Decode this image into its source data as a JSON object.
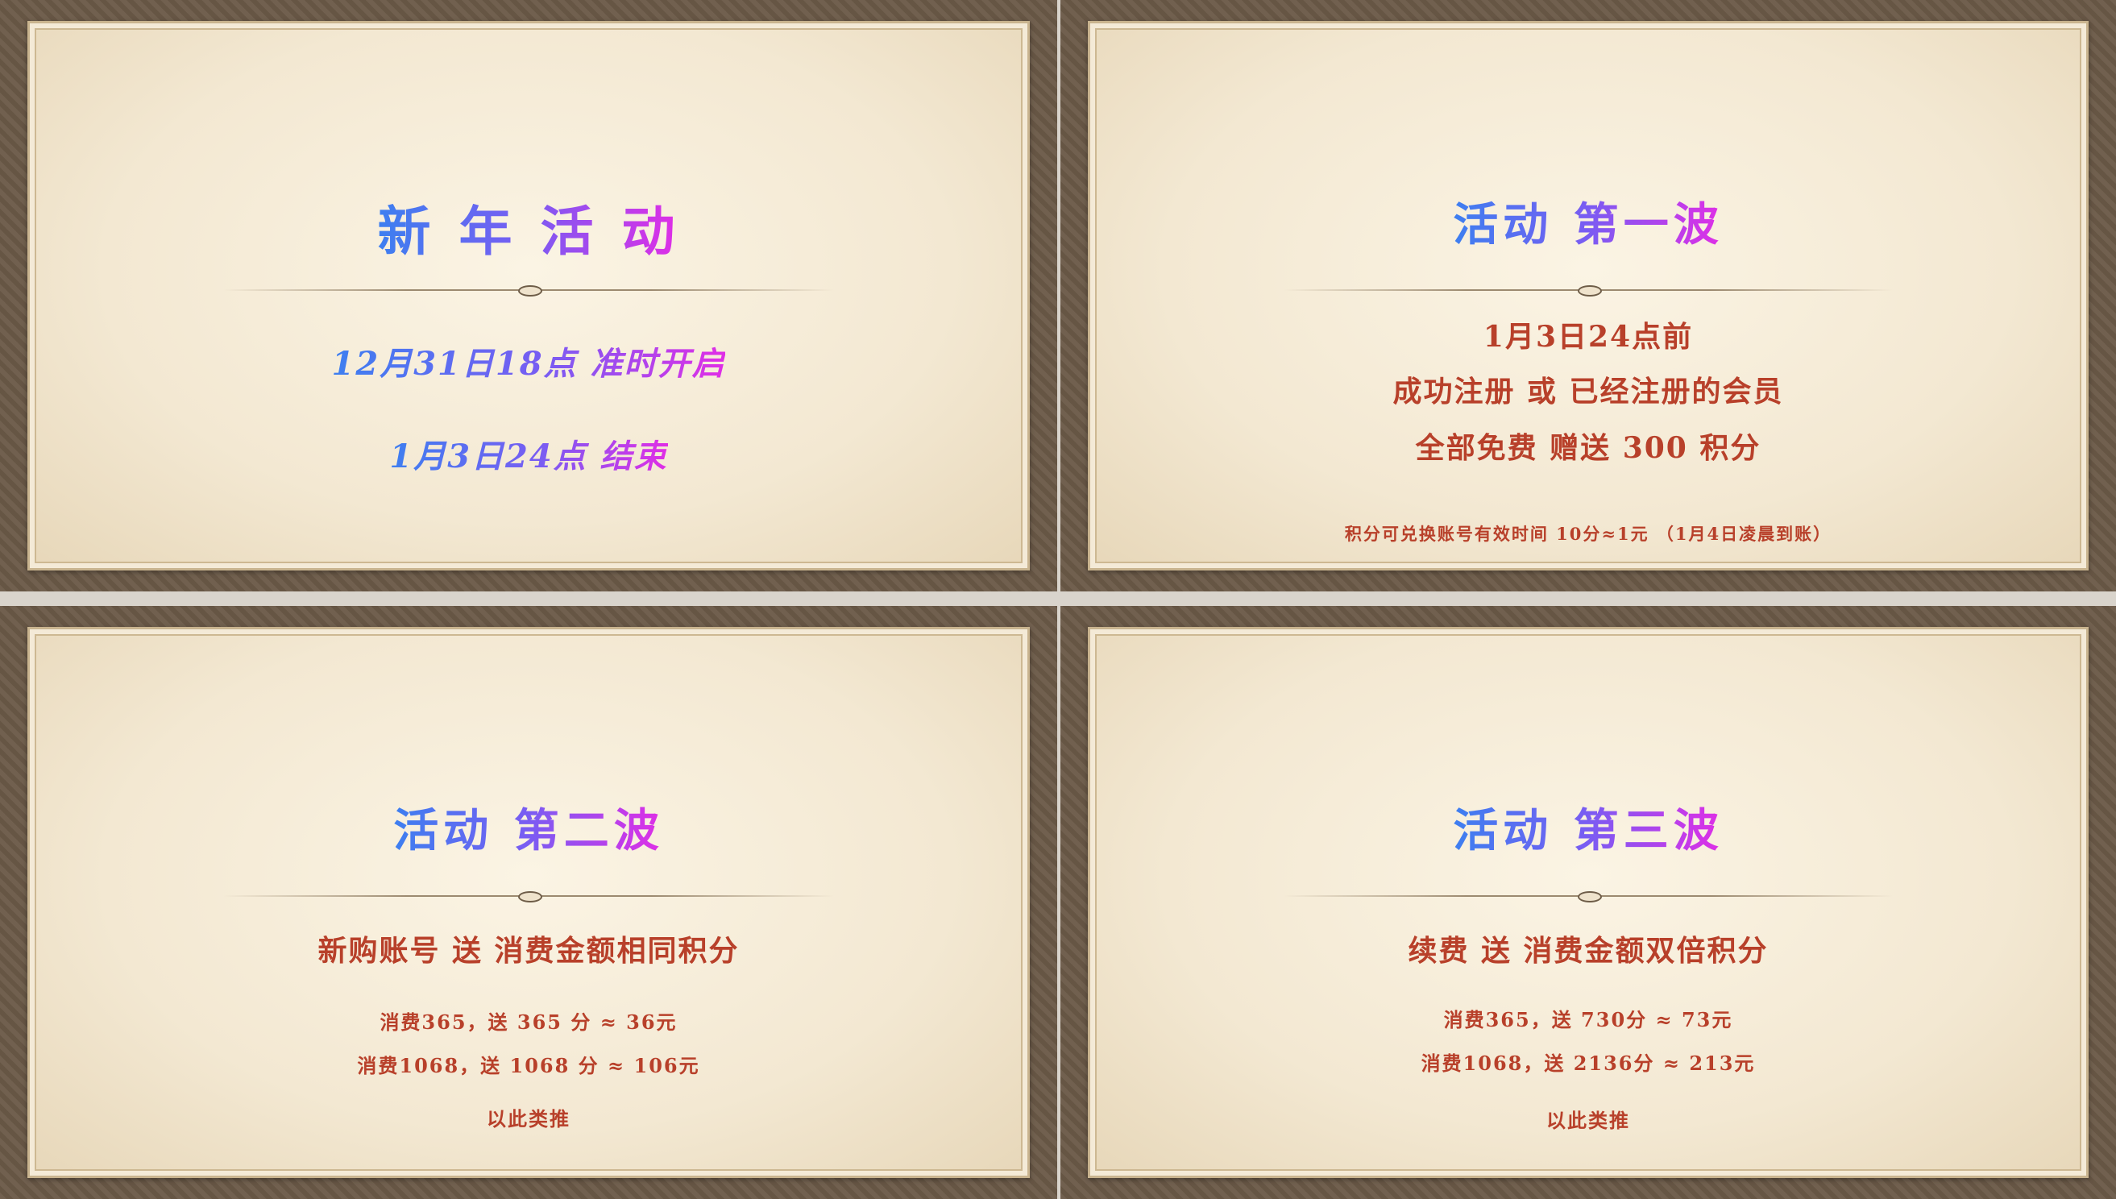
{
  "slides": [
    {
      "title": "新 年 活 动",
      "lines": [
        "12月31日18点 准时开启",
        "1月3日24点 结束"
      ]
    },
    {
      "title": "活动 第一波",
      "lines": [
        "1月3日24点前",
        "成功注册 或 已经注册的会员",
        "全部免费 赠送 300 积分"
      ],
      "note": "积分可兑换账号有效时间 10分≈1元 （1月4日凌晨到账）"
    },
    {
      "title": "活动 第二波",
      "headline": "新购账号 送 消费金额相同积分",
      "examples": [
        "消费365，送 365 分 ≈ 36元",
        "消费1068，送 1068 分 ≈ 106元"
      ],
      "footer": "以此类推"
    },
    {
      "title": "活动 第三波",
      "headline": "续费 送 消费金额双倍积分",
      "examples": [
        "消费365，送 730分 ≈ 73元",
        "消费1068，送 2136分 ≈ 213元"
      ],
      "footer": "以此类推"
    }
  ],
  "colors": {
    "frame": "#6b5a48",
    "paper": "#f6ecd8",
    "accent_red": "#b8402a",
    "gradient_start": "#3d7ff0",
    "gradient_end": "#e02ee6"
  },
  "icons": [
    "divider-knot-icon"
  ]
}
